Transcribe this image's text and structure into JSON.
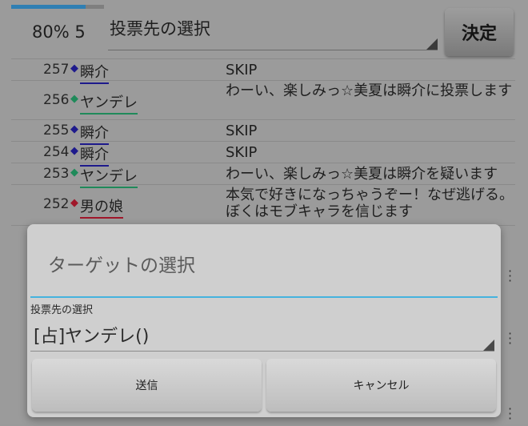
{
  "header": {
    "progress_percent": 80,
    "progress_text": "80% 5",
    "vote_select_label": "投票先の選択",
    "decide_label": "決定",
    "accent_color": "#2f7fb3"
  },
  "log": {
    "rows": [
      {
        "num": "257",
        "name": "瞬介",
        "diamond_color": "#1e1a8c",
        "underline_color": "#1e1a8c",
        "message": "SKIP"
      },
      {
        "num": "256",
        "name": "ヤンデレ",
        "diamond_color": "#1f8a5a",
        "underline_color": "#1f8a5a",
        "message": "わーい、楽しみっ☆美夏は瞬介に投票します"
      },
      {
        "num": "255",
        "name": "瞬介",
        "diamond_color": "#1e1a8c",
        "underline_color": "#1e1a8c",
        "message": "SKIP"
      },
      {
        "num": "254",
        "name": "瞬介",
        "diamond_color": "#1e1a8c",
        "underline_color": "#1e1a8c",
        "message": "SKIP"
      },
      {
        "num": "253",
        "name": "ヤンデレ",
        "diamond_color": "#1f8a5a",
        "underline_color": "#1f8a5a",
        "message": "わーい、楽しみっ☆美夏は瞬介を疑います"
      },
      {
        "num": "252",
        "name": "男の娘",
        "diamond_color": "#a0172a",
        "underline_color": "#a0172a",
        "message": "本気で好きになっちゃうぞー！なぜ逃げる。ぼくはモブキャラを信じます"
      }
    ]
  },
  "dialog": {
    "title": "ターゲットの選択",
    "field_label": "投票先の選択",
    "selected_value": "[占]ヤンデレ()",
    "send_label": "送信",
    "cancel_label": "キャンセル",
    "divider_color": "#45b3de"
  },
  "icons": {
    "menu": "more-vert-icon",
    "dropdown": "dropdown-caret-icon"
  }
}
